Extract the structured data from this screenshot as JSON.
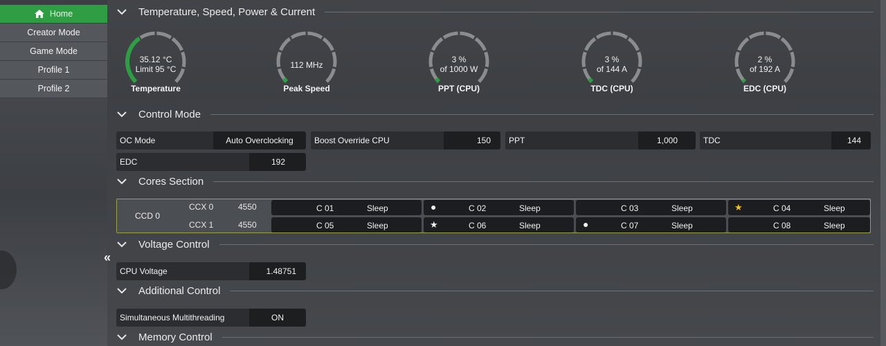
{
  "sidebar": {
    "items": [
      {
        "label": "Home",
        "active": true
      },
      {
        "label": "Creator Mode",
        "active": false
      },
      {
        "label": "Game Mode",
        "active": false
      },
      {
        "label": "Profile 1",
        "active": false
      },
      {
        "label": "Profile 2",
        "active": false
      }
    ]
  },
  "sections": {
    "temp": "Temperature, Speed, Power & Current",
    "control": "Control Mode",
    "cores": "Cores Section",
    "voltage": "Voltage Control",
    "additional": "Additional Control",
    "memory": "Memory Control"
  },
  "gauges": [
    {
      "line1": "35.12 °C",
      "line2": "Limit 95 °C",
      "caption": "Temperature",
      "fraction": 0.37
    },
    {
      "line1": "112  MHz",
      "line2": "",
      "caption": "Peak Speed",
      "fraction": 0.03
    },
    {
      "line1": "3 %",
      "line2": "of 1000 W",
      "caption": "PPT (CPU)",
      "fraction": 0.03
    },
    {
      "line1": "3 %",
      "line2": "of 144 A",
      "caption": "TDC (CPU)",
      "fraction": 0.03
    },
    {
      "line1": "2 %",
      "line2": "of 192 A",
      "caption": "EDC (CPU)",
      "fraction": 0.02
    }
  ],
  "control": {
    "oc_mode": {
      "label": "OC Mode",
      "value": "Auto Overclocking"
    },
    "boost": {
      "label": "Boost Override CPU",
      "value": "150"
    },
    "ppt": {
      "label": "PPT",
      "value": "1,000"
    },
    "tdc": {
      "label": "TDC",
      "value": "144"
    },
    "edc": {
      "label": "EDC",
      "value": "192"
    }
  },
  "cores": {
    "ccd": "CCD 0",
    "ccx": [
      {
        "name": "CCX 0",
        "freq": "4550"
      },
      {
        "name": "CCX 1",
        "freq": "4550"
      }
    ],
    "list": [
      {
        "name": "C 01",
        "state": "Sleep",
        "mark": ""
      },
      {
        "name": "C 02",
        "state": "Sleep",
        "mark": "dot"
      },
      {
        "name": "C 03",
        "state": "Sleep",
        "mark": ""
      },
      {
        "name": "C 04",
        "state": "Sleep",
        "mark": "star-gold"
      },
      {
        "name": "C 05",
        "state": "Sleep",
        "mark": ""
      },
      {
        "name": "C 06",
        "state": "Sleep",
        "mark": "star"
      },
      {
        "name": "C 07",
        "state": "Sleep",
        "mark": "dot"
      },
      {
        "name": "C 08",
        "state": "Sleep",
        "mark": ""
      }
    ]
  },
  "voltage": {
    "label": "CPU Voltage",
    "value": "1.48751"
  },
  "additional": {
    "label": "Simultaneous Multithreading",
    "value": "ON"
  },
  "colors": {
    "accent": "#2f9d44",
    "gauge_track": "#8a8d90",
    "cores_border": "#9aa14a",
    "favorite_star": "#f2c21b"
  }
}
